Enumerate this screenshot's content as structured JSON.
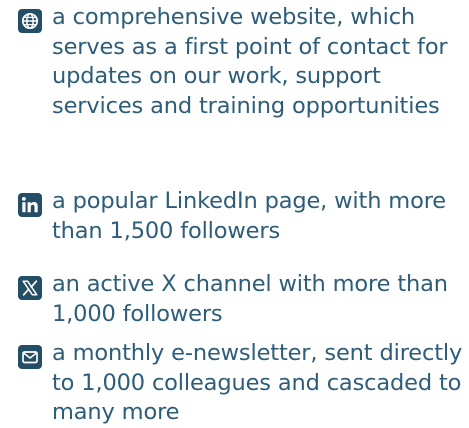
{
  "colors": {
    "text": "#2d5d79",
    "icon_background": "#244e66",
    "icon_foreground": "#ffffff",
    "page_background": "#ffffff"
  },
  "items": [
    {
      "icon": "globe-icon",
      "text": "a comprehensive website, which serves as a first point of contact for updates on our work, support services and training opportunities"
    },
    {
      "icon": "linkedin-icon",
      "text": "a popular LinkedIn page, with more than 1,500 followers"
    },
    {
      "icon": "x-icon",
      "text": "an active X channel with more than 1,000 followers"
    },
    {
      "icon": "envelope-icon",
      "text": "a monthly e-newsletter, sent directly to 1,000 colleagues and cascaded to many more"
    }
  ]
}
